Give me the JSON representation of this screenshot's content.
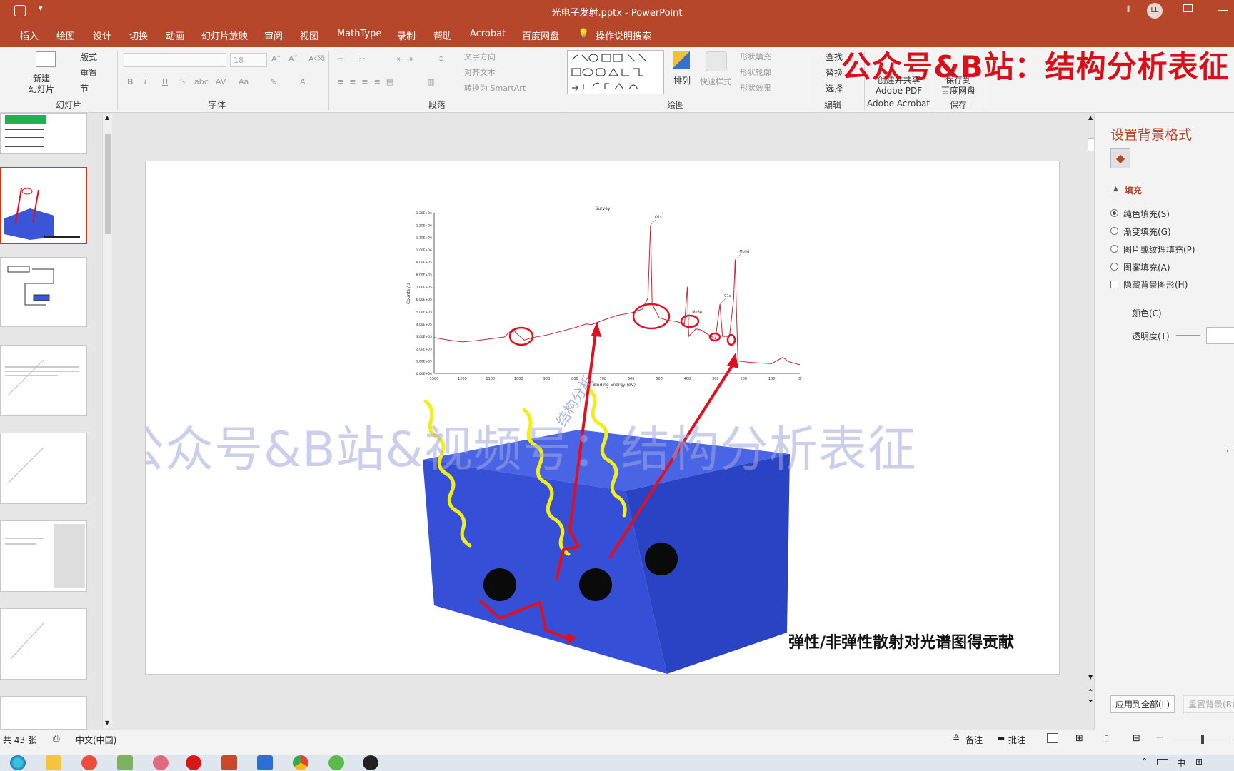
{
  "app": {
    "title": "光电子发射.pptx  -  PowerPoint",
    "user_initials": "LL"
  },
  "tabs": [
    "插入",
    "绘图",
    "设计",
    "切换",
    "动画",
    "幻灯片放映",
    "审阅",
    "视图",
    "MathType",
    "录制",
    "帮助",
    "Acrobat",
    "百度网盘"
  ],
  "tell_me": "操作说明搜索",
  "ribbon": {
    "slides": {
      "new_slide": "新建\n幻灯片",
      "layout": "版式",
      "reset": "重置",
      "section": "节",
      "group": "幻灯片"
    },
    "font": {
      "size": "18",
      "bold": "B",
      "italic": "I",
      "underline": "U",
      "strike": "S",
      "group": "字体"
    },
    "paragraph": {
      "text_direction": "文字方向",
      "align_text": "对齐文本",
      "smartart": "转换为 SmartArt",
      "group": "段落"
    },
    "drawing": {
      "arrange": "排列",
      "quick_styles": "快速样式",
      "shape_fill": "形状填充",
      "shape_outline": "形状轮廓",
      "shape_effects": "形状效果",
      "group": "绘图"
    },
    "editing": {
      "find": "查找",
      "replace": "替换",
      "select": "选择",
      "group": "编辑"
    },
    "acrobat": {
      "create": "创建并共享\nAdobe PDF",
      "group": "Adobe Acrobat"
    },
    "save": {
      "save_baidu": "保存到\n百度网盘",
      "group": "保存"
    }
  },
  "watermark_banner": "公众号&B站：结构分析表征",
  "slide": {
    "watermark": "公众号&B站&视频号：结构分析表征",
    "watermark_diag": "结构分析",
    "caption": "弹性/非弹性散射对光谱图得贡献",
    "chart": {
      "title": "Survey",
      "xlabel": "Binding Energy (eV)",
      "ylabel": "Counts / s"
    }
  },
  "chart_data": {
    "type": "line",
    "title": "Survey",
    "xlabel": "Binding Energy (eV)",
    "ylabel": "Counts / s",
    "x_ticks": [
      "1300",
      "1200",
      "1100",
      "1000",
      "900",
      "800",
      "700",
      "600",
      "500",
      "400",
      "300",
      "200",
      "100",
      "0"
    ],
    "y_ticks": [
      "0.00E+00",
      "1.00E+05",
      "2.00E+05",
      "3.00E+05",
      "4.00E+05",
      "5.00E+05",
      "6.00E+05",
      "7.00E+05",
      "8.00E+05",
      "9.00E+05",
      "1.00E+06",
      "1.10E+06",
      "1.20E+06",
      "1.30E+06"
    ],
    "xlim": [
      1300,
      0
    ],
    "ylim": [
      0,
      1300000
    ],
    "peaks": [
      {
        "label": "O1s",
        "x": 531,
        "y": 1200000
      },
      {
        "label": "Mo3p",
        "x": 398,
        "y": 430000
      },
      {
        "label": "C1s",
        "x": 284,
        "y": 560000
      },
      {
        "label": "Mo3d",
        "x": 230,
        "y": 920000
      }
    ],
    "series": [
      {
        "color": "#c0283a",
        "points": [
          [
            1300,
            290000
          ],
          [
            1250,
            270000
          ],
          [
            1200,
            255000
          ],
          [
            1150,
            265000
          ],
          [
            1100,
            280000
          ],
          [
            1050,
            295000
          ],
          [
            1020,
            360000
          ],
          [
            1010,
            330000
          ],
          [
            980,
            270000
          ],
          [
            950,
            290000
          ],
          [
            900,
            310000
          ],
          [
            850,
            340000
          ],
          [
            800,
            370000
          ],
          [
            760,
            400000
          ],
          [
            740,
            395000
          ],
          [
            700,
            430000
          ],
          [
            650,
            470000
          ],
          [
            600,
            490000
          ],
          [
            560,
            520000
          ],
          [
            540,
            610000
          ],
          [
            531,
            1200000
          ],
          [
            525,
            560000
          ],
          [
            500,
            450000
          ],
          [
            470,
            430000
          ],
          [
            440,
            420000
          ],
          [
            410,
            400000
          ],
          [
            400,
            700000
          ],
          [
            395,
            300000
          ],
          [
            370,
            360000
          ],
          [
            350,
            350000
          ],
          [
            330,
            320000
          ],
          [
            300,
            280000
          ],
          [
            284,
            560000
          ],
          [
            275,
            300000
          ],
          [
            250,
            300000
          ],
          [
            235,
            610000
          ],
          [
            230,
            920000
          ],
          [
            226,
            560000
          ],
          [
            220,
            100000
          ],
          [
            180,
            90000
          ],
          [
            150,
            85000
          ],
          [
            100,
            80000
          ],
          [
            60,
            130000
          ],
          [
            40,
            95000
          ],
          [
            0,
            70000
          ]
        ]
      }
    ]
  },
  "format_pane": {
    "title": "设置背景格式",
    "section": "填充",
    "options": [
      "纯色填充(S)",
      "渐变填充(G)",
      "图片或纹理填充(P)",
      "图案填充(A)"
    ],
    "checkbox": "隐藏背景图形(H)",
    "color_label": "颜色(C)",
    "transparency_label": "透明度(T)",
    "apply_all": "应用到全部(L)",
    "reset_bg": "重置背景(B)"
  },
  "status": {
    "slide_count": "共 43 张",
    "language": "中文(中国)",
    "notes": "备注",
    "comments": "批注"
  },
  "colors": {
    "accent": "#b7472a",
    "cube": "#3b55d8",
    "arrow": "#e01020",
    "wave": "#f2ee1a"
  }
}
